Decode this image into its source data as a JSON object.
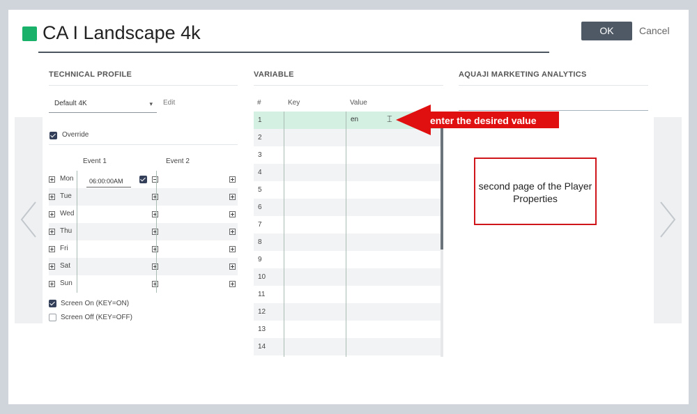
{
  "header": {
    "title": "CA I Landscape 4k",
    "title_swatch_color": "#1ab26b",
    "ok_label": "OK",
    "cancel_label": "Cancel"
  },
  "technical_profile": {
    "heading": "TECHNICAL PROFILE",
    "profile_value": "Default 4K",
    "edit_label": "Edit",
    "override_label": "Override",
    "override_checked": true,
    "event1_label": "Event 1",
    "event2_label": "Event 2",
    "days": [
      {
        "label": "Mon",
        "event1": "06:00:00AM"
      },
      {
        "label": "Tue",
        "event1": ""
      },
      {
        "label": "Wed",
        "event1": ""
      },
      {
        "label": "Thu",
        "event1": ""
      },
      {
        "label": "Fri",
        "event1": ""
      },
      {
        "label": "Sat",
        "event1": ""
      },
      {
        "label": "Sun",
        "event1": ""
      }
    ],
    "screen_on_label": "Screen On (KEY=ON)",
    "screen_on_checked": true,
    "screen_off_label": "Screen Off (KEY=OFF)",
    "screen_off_checked": false
  },
  "variable": {
    "heading": "VARIABLE",
    "columns": [
      "#",
      "Key",
      "Value"
    ],
    "rows": [
      "1",
      "2",
      "3",
      "4",
      "5",
      "6",
      "7",
      "8",
      "9",
      "10",
      "11",
      "12",
      "13",
      "14"
    ],
    "editing_value": "en"
  },
  "analytics": {
    "heading": "AQUAJI MARKETING ANALYTICS"
  },
  "annotations": {
    "callout": "enter the desired value",
    "callout_color": "#e01010",
    "note": "second page of the Player Properties",
    "note_border_color": "#d0151a"
  }
}
